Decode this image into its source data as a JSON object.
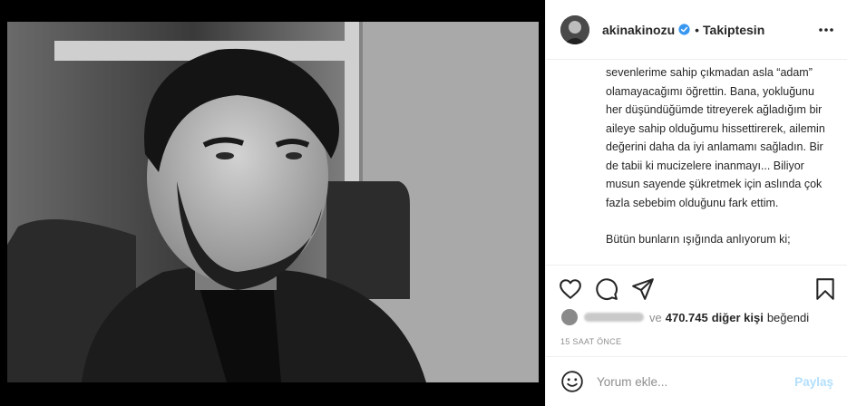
{
  "photo": {
    "alt": "",
    "mode": "grayscale"
  },
  "header": {
    "username": "akinakinozu",
    "verified_icon": "verified-badge-icon",
    "separator": "•",
    "follow_label": "Takiptesin",
    "more_icon": "more-options-icon"
  },
  "caption": {
    "paragraph1": "sevenlerime sahip çıkmadan asla “adam” olamayacağımı öğrettin. Bana, yokluğunu her düşündüğümde titreyerek ağladığım bir aileye sahip olduğumu hissettirerek, ailemin değerini daha da iyi anlamamı sağladın. Bir de tabii ki mucizelere inanmayı... Biliyor musun sayende şükretmek için aslında çok fazla sebebim olduğunu fark ettim.",
    "paragraph2": "Bütün bunların ışığında anlıyorum ki;"
  },
  "actions": {
    "like_icon": "heart-icon",
    "comment_icon": "comment-icon",
    "share_icon": "send-icon",
    "save_icon": "bookmark-icon"
  },
  "likes": {
    "connector": "ve",
    "count": "470.745",
    "tail_label": "diğer kişi",
    "verb": "beğendi"
  },
  "timestamp": "15 SAAT ÖNCE",
  "comment": {
    "emoji_icon": "emoji-icon",
    "placeholder": "Yorum ekle...",
    "post_label": "Paylaş"
  },
  "colors": {
    "link_disabled": "#b2dffc",
    "verified_blue": "#3897f0",
    "divider": "#efefef",
    "muted": "#8e8e8e"
  }
}
